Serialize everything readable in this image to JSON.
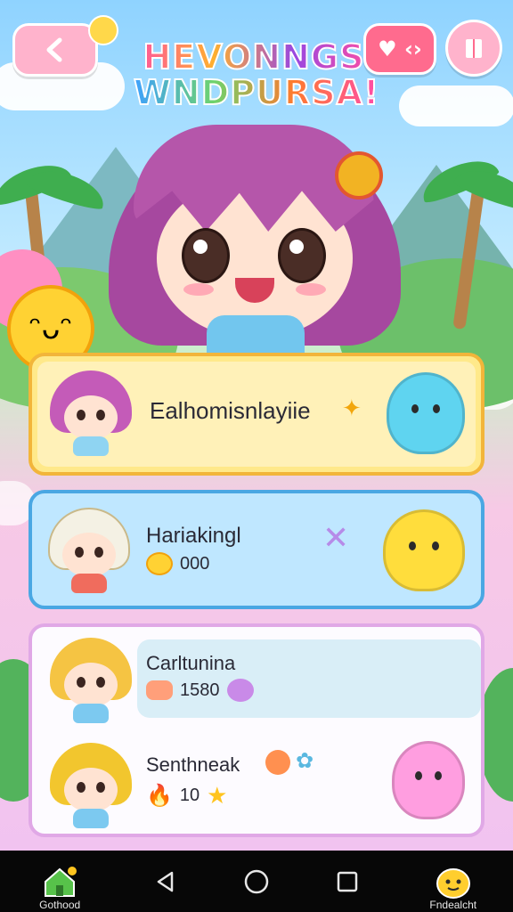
{
  "header": {
    "title_line1": "HEVONNGS",
    "title_line2": "WNDPURSA!",
    "back_icon": "chevron-left-icon",
    "toggle_icon": "heart-toggle-icon",
    "book_icon": "book-icon"
  },
  "hero": {
    "character": "purple-haired-girl"
  },
  "cards": [
    {
      "name": "Ealhomisnlayiie",
      "stat_icon": "",
      "stat": ""
    },
    {
      "name": "Hariakingl",
      "stat_icon": "coin-icon",
      "stat": "000"
    },
    {
      "name": "Carltunina",
      "stat_icon": "cake-icon",
      "stat": "1580"
    },
    {
      "name": "Senthneak",
      "stat_icon": "flame-icon",
      "stat": "10"
    }
  ],
  "navbar": {
    "left_label": "Gothood",
    "right_label": "Fndealcht",
    "home_icon": "home-icon",
    "back_icon": "triangle-back-icon",
    "circle_icon": "circle-home-icon",
    "square_icon": "square-recents-icon",
    "mascot_icon": "mascot-icon"
  },
  "colors": {
    "card1": "#ffe98a",
    "card2": "#bfe7ff",
    "card3": "#fdfbff",
    "accent_pink": "#ff6fa9"
  }
}
